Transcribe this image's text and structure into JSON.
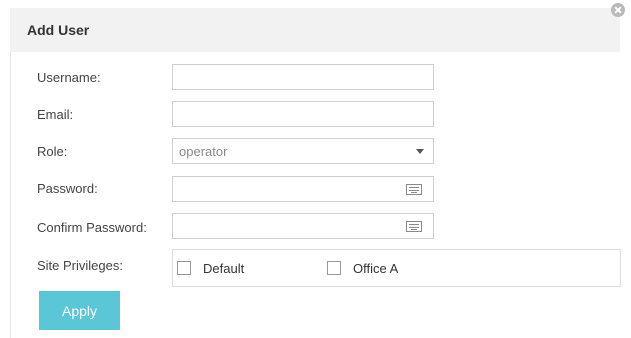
{
  "dialog": {
    "title": "Add User",
    "close_icon": "close-circle-icon"
  },
  "form": {
    "username": {
      "label": "Username:",
      "value": "",
      "placeholder": ""
    },
    "email": {
      "label": "Email:",
      "value": "",
      "placeholder": ""
    },
    "role": {
      "label": "Role:",
      "selected": "operator"
    },
    "password": {
      "label": "Password:",
      "value": "",
      "icon": "keyboard-icon"
    },
    "confirm_password": {
      "label": "Confirm Password:",
      "value": "",
      "icon": "keyboard-icon"
    },
    "site_privileges": {
      "label": "Site Privileges:",
      "options": [
        {
          "label": "Default",
          "checked": false
        },
        {
          "label": "Office A",
          "checked": false
        }
      ]
    }
  },
  "actions": {
    "apply_label": "Apply"
  },
  "colors": {
    "header_bg": "#f2f2f2",
    "apply_button": "#5bc6d6",
    "border": "#cfcfcf"
  }
}
